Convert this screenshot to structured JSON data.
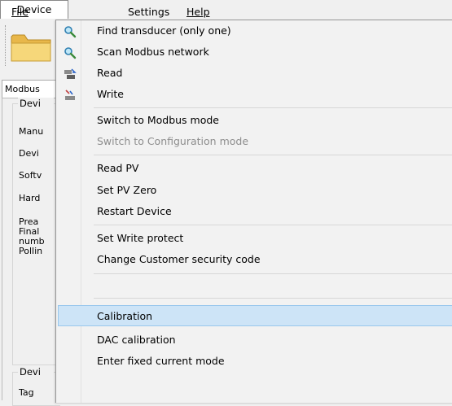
{
  "menubar": {
    "file": "File",
    "device": "Device",
    "settings": "Settings",
    "help": "Help"
  },
  "background": {
    "tab_label": "Modbus",
    "group1_title": "Devi",
    "group2_title": "Devi",
    "labels": [
      "Manu",
      "Devi",
      "Softv",
      "Hard",
      "Prea",
      "Final",
      "numb",
      "Pollin",
      "Tag"
    ]
  },
  "menu": {
    "find_transducer": {
      "label": "Find transducer (only one)",
      "icon": "magnifier-icon"
    },
    "scan_modbus": {
      "label": "Scan Modbus network",
      "icon": "magnifier-icon"
    },
    "read": {
      "label": "Read",
      "icon": "read-device-icon"
    },
    "write": {
      "label": "Write",
      "icon": "write-device-icon"
    },
    "switch_modbus": {
      "label": "Switch to Modbus mode"
    },
    "switch_config": {
      "label": "Switch to Configuration mode",
      "disabled": true
    },
    "read_pv": {
      "label": "Read PV"
    },
    "set_pv_zero": {
      "label": "Set PV Zero"
    },
    "restart_device": {
      "label": "Restart Device"
    },
    "set_write_protect": {
      "label": "Set Write protect"
    },
    "change_security": {
      "label": "Change Customer security code"
    },
    "calibration": {
      "label": "Calibration",
      "highlighted": true
    },
    "dac_calibration": {
      "label": "DAC calibration"
    },
    "fixed_current": {
      "label": "Enter fixed current mode"
    }
  },
  "colors": {
    "highlight_bg": "#cde4f7",
    "highlight_border": "#99c7ed",
    "disabled_text": "#8d8d8d"
  }
}
